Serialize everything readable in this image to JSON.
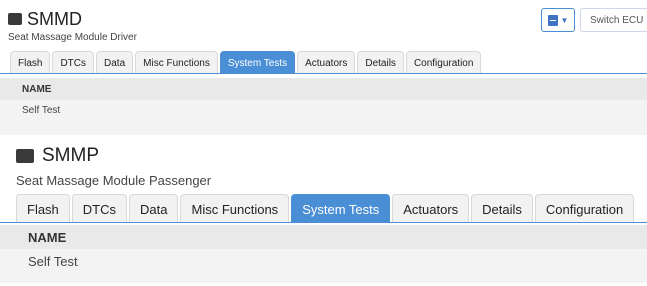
{
  "modules": [
    {
      "title": "SMMD",
      "subtitle": "Seat Massage Module Driver",
      "tabs": [
        "Flash",
        "DTCs",
        "Data",
        "Misc Functions",
        "System Tests",
        "Actuators",
        "Details",
        "Configuration"
      ],
      "active_tab": "System Tests",
      "table": {
        "header": "NAME",
        "rows": [
          "Self Test"
        ]
      }
    },
    {
      "title": "SMMP",
      "subtitle": "Seat Massage Module Passenger",
      "tabs": [
        "Flash",
        "DTCs",
        "Data",
        "Misc Functions",
        "System Tests",
        "Actuators",
        "Details",
        "Configuration"
      ],
      "active_tab": "System Tests",
      "table": {
        "header": "NAME",
        "rows": [
          "Self Test"
        ]
      }
    }
  ],
  "toolbar": {
    "view_icon": "module-view-icon",
    "switch_label": "Switch ECU"
  },
  "colors": {
    "accent": "#4a8fd6",
    "icon": "#3a3a3a",
    "panel": "#f3f3f3"
  }
}
